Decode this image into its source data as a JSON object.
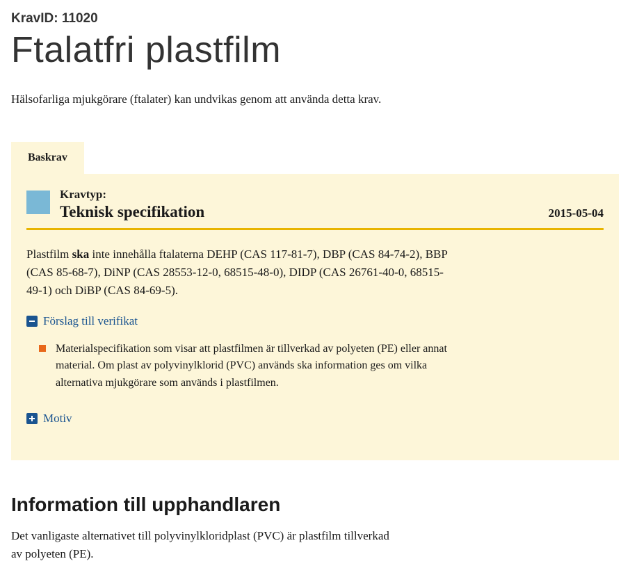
{
  "kravId": {
    "label": "KravID: ",
    "value": "11020"
  },
  "title": "Ftalatfri plastfilm",
  "intro": "Hälsofarliga mjukgörare (ftalater) kan undvikas genom att använda detta krav.",
  "tabs": {
    "baskrav": "Baskrav"
  },
  "krav": {
    "kravtypLabel": "Kravtyp:",
    "spec": "Teknisk specifikation",
    "date": "2015-05-04",
    "body": {
      "pre": "Plastfilm ",
      "ska": "ska",
      "post": " inte innehålla ftalaterna DEHP (CAS 117-81-7), DBP (CAS 84-74-2), BBP (CAS 85-68-7), DiNP (CAS 28553-12-0, 68515-48-0), DIDP (CAS 26761-40-0, 68515-49-1) och DiBP (CAS 84-69-5)."
    },
    "verifikat": {
      "toggleLabel": "Förslag till verifikat",
      "items": [
        "Materialspecifikation som visar att plastfilmen är tillverkad av polyeten (PE) eller annat material. Om plast av polyvinylklorid (PVC) används ska information ges om vilka alternativa mjukgörare som används i plastfilmen."
      ]
    },
    "motiv": {
      "toggleLabel": "Motiv"
    }
  },
  "info": {
    "heading": "Information till upphandlaren",
    "body": "Det vanligaste alternativet till polyvinylkloridplast (PVC) är plastfilm tillverkad av polyeten (PE)."
  }
}
